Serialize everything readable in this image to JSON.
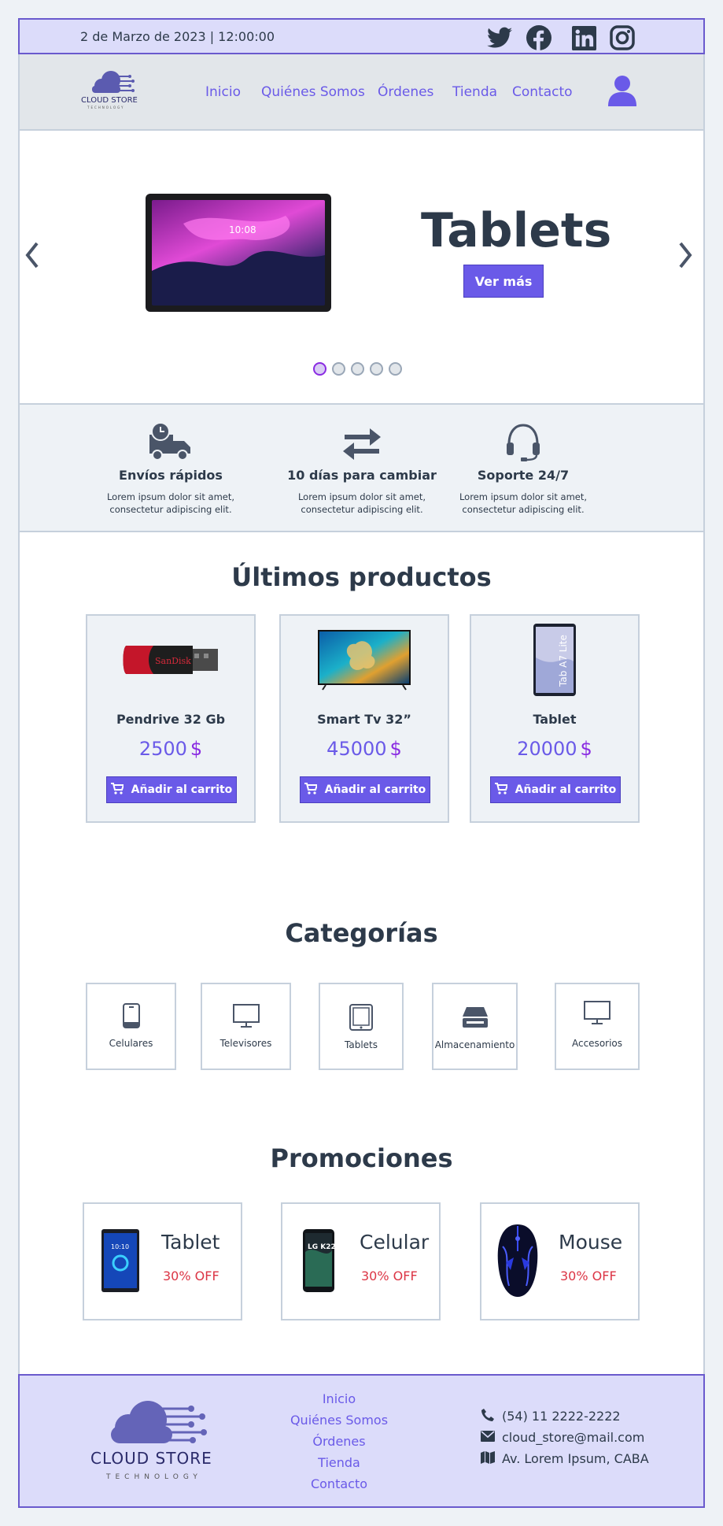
{
  "topbar": {
    "datetime": "2 de Marzo de 2023 | 12:00:00",
    "social": [
      "twitter-icon",
      "facebook-icon",
      "linkedin-icon",
      "instagram-icon"
    ]
  },
  "header": {
    "logo_text": "CLOUD STORE",
    "logo_subtext": "TECHNOLOGY",
    "nav": [
      "Inicio",
      "Quiénes Somos",
      "Órdenes",
      "Tienda",
      "Contacto"
    ]
  },
  "hero": {
    "title": "Tablets",
    "button": "Ver más",
    "slides": 5,
    "active_slide": 1,
    "device_time": "10:08"
  },
  "features": [
    {
      "icon": "delivery-truck-icon",
      "title": "Envíos rápidos",
      "text": "Lorem ipsum dolor sit amet, consectetur adipiscing elit."
    },
    {
      "icon": "exchange-arrows-icon",
      "title": "10 días para cambiar",
      "text": "Lorem ipsum dolor sit amet, consectetur adipiscing elit."
    },
    {
      "icon": "headset-icon",
      "title": "Soporte 24/7",
      "text": "Lorem ipsum dolor sit amet, consectetur adipiscing elit."
    }
  ],
  "latest": {
    "title": "Últimos productos",
    "products": [
      {
        "name": "Pendrive 32 Gb",
        "price": "2500",
        "currency": "$",
        "button": "Añadir al carrito",
        "brand_label": "SanDisk"
      },
      {
        "name": "Smart Tv 32”",
        "price": "45000",
        "currency": "$",
        "button": "Añadir al carrito"
      },
      {
        "name": "Tablet",
        "price": "20000",
        "currency": "$",
        "button": "Añadir al carrito",
        "device_label": "Tab A7 Lite"
      }
    ]
  },
  "categories": {
    "title": "Categorías",
    "items": [
      {
        "label": "Celulares",
        "icon": "mobile-phone-icon"
      },
      {
        "label": "Televisores",
        "icon": "monitor-icon"
      },
      {
        "label": "Tablets",
        "icon": "tablet-icon"
      },
      {
        "label": "Almacenamiento",
        "icon": "hard-drive-icon"
      },
      {
        "label": "Accesorios",
        "icon": "monitor-icon"
      }
    ]
  },
  "promotions": {
    "title": "Promociones",
    "items": [
      {
        "name": "Tablet",
        "discount": "30% OFF",
        "device_text": "10:10"
      },
      {
        "name": "Celular",
        "discount": "30% OFF",
        "device_text": "LG K22"
      },
      {
        "name": "Mouse",
        "discount": "30% OFF"
      }
    ]
  },
  "footer": {
    "logo_text": "CLOUD STORE",
    "logo_subtext": "TECHNOLOGY",
    "links": [
      "Inicio",
      "Quiénes Somos",
      "Órdenes",
      "Tienda",
      "Contacto"
    ],
    "phone": "(54) 11 2222-2222",
    "email": "cloud_store@mail.com",
    "address": "Av. Lorem Ipsum, CABA"
  },
  "colors": {
    "accent": "#6a5ae8",
    "topbar_bg": "#dcdcfa",
    "text": "#2d3a4a",
    "discount": "#dc3545"
  }
}
